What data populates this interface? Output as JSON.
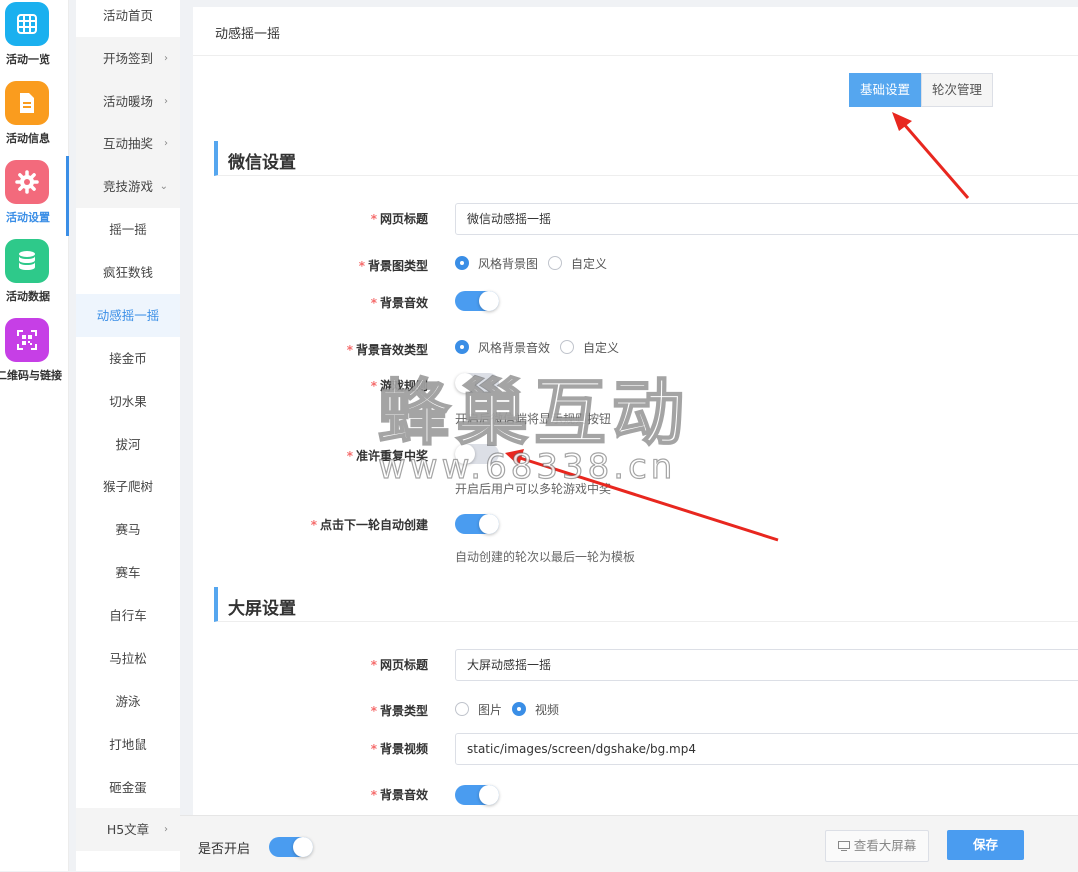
{
  "rail": [
    {
      "label": "活动一览",
      "icon": "grid-icon",
      "color": "#1ab0ef"
    },
    {
      "label": "活动信息",
      "icon": "document-icon",
      "color": "#fa9c1e"
    },
    {
      "label": "活动设置",
      "icon": "gear-icon",
      "color": "#f36a7c"
    },
    {
      "label": "活动数据",
      "icon": "database-icon",
      "color": "#2ec98a"
    },
    {
      "label": "二维码与链接",
      "icon": "qrcode-icon",
      "color": "#c63fe6"
    }
  ],
  "submenu": [
    {
      "label": "活动首页"
    },
    {
      "label": "开场签到",
      "arrow": "›"
    },
    {
      "label": "活动暖场",
      "arrow": "›"
    },
    {
      "label": "互动抽奖",
      "arrow": "›"
    },
    {
      "label": "竞技游戏",
      "arrow": "⌄"
    },
    {
      "label": "摇一摇"
    },
    {
      "label": "疯狂数钱"
    },
    {
      "label": "动感摇一摇"
    },
    {
      "label": "接金币"
    },
    {
      "label": "切水果"
    },
    {
      "label": "拔河"
    },
    {
      "label": "猴子爬树"
    },
    {
      "label": "赛马"
    },
    {
      "label": "赛车"
    },
    {
      "label": "自行车"
    },
    {
      "label": "马拉松"
    },
    {
      "label": "游泳"
    },
    {
      "label": "打地鼠"
    },
    {
      "label": "砸金蛋"
    },
    {
      "label": "H5文章",
      "arrow": "›"
    }
  ],
  "panel": {
    "title": "动感摇一摇",
    "tabs": [
      "基础设置",
      "轮次管理"
    ]
  },
  "wechat": {
    "section": "微信设置",
    "page_title_label": "网页标题",
    "page_title_value": "微信动感摇一摇",
    "bg_type_label": "背景图类型",
    "bg_type_opt1": "风格背景图",
    "bg_type_opt2": "自定义",
    "bg_sound_label": "背景音效",
    "bg_sound_type_label": "背景音效类型",
    "bg_sound_type_opt1": "风格背景音效",
    "bg_sound_type_opt2": "自定义",
    "rules_label": "游戏规则",
    "rules_hint": "开启后微信端将显示规则按钮",
    "repeat_win_label": "准许重复中奖",
    "repeat_win_hint": "开启后用户可以多轮游戏中奖",
    "auto_create_label": "点击下一轮自动创建",
    "auto_create_hint": "自动创建的轮次以最后一轮为模板"
  },
  "screen": {
    "section": "大屏设置",
    "page_title_label": "网页标题",
    "page_title_value": "大屏动感摇一摇",
    "bg_type_label": "背景类型",
    "bg_type_opt1": "图片",
    "bg_type_opt2": "视频",
    "bg_video_label": "背景视频",
    "bg_video_value": "static/images/screen/dgshake/bg.mp4",
    "bg_sound_label": "背景音效"
  },
  "bottom": {
    "enable_label": "是否开启",
    "preview_label": "查看大屏幕",
    "save_label": "保存"
  },
  "watermark": {
    "line1": "蜂巢互动",
    "line2": "www.68338.cn"
  },
  "colors": {
    "accent": "#4a9cf0",
    "arrow": "#e8271f"
  }
}
